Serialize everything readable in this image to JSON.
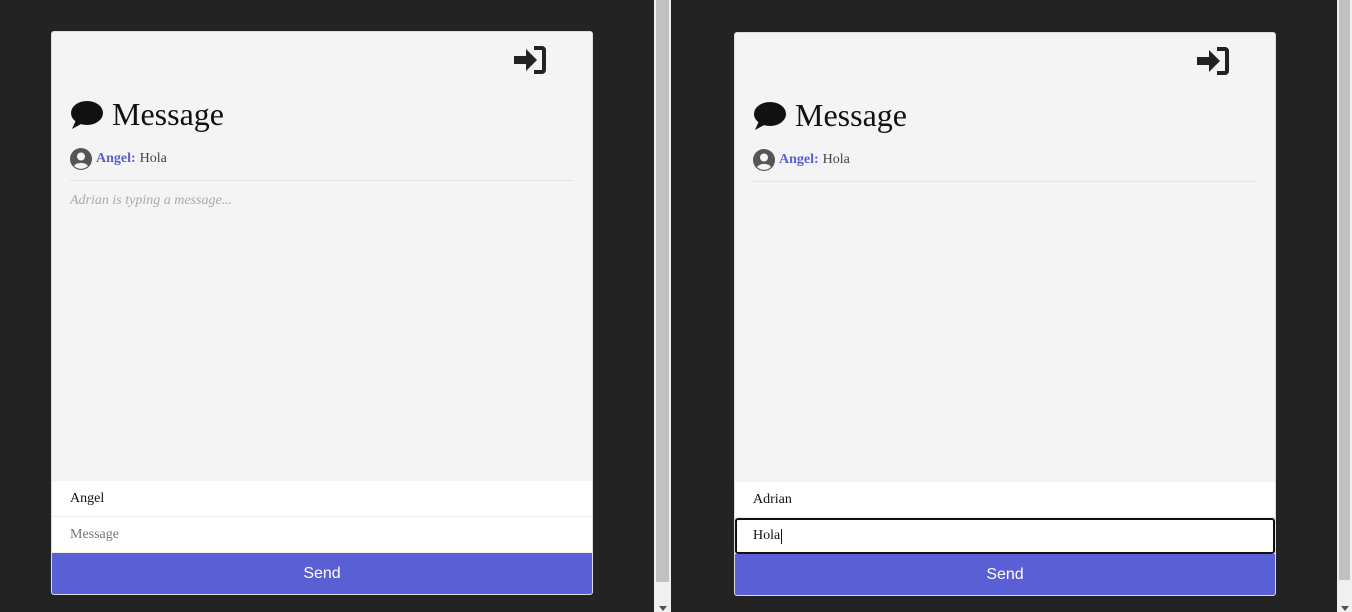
{
  "panes": {
    "left": {
      "title": "Message",
      "messages": [
        {
          "author": "Angel:",
          "text": "Hola"
        }
      ],
      "typing_indicator": "Adrian is typing a message...",
      "name_value": "Angel",
      "message_placeholder": "Message",
      "message_value": "",
      "send_label": "Send"
    },
    "right": {
      "title": "Message",
      "messages": [
        {
          "author": "Angel:",
          "text": "Hola"
        }
      ],
      "typing_indicator": "",
      "name_value": "Adrian",
      "message_placeholder": "Message",
      "message_value": "Hola",
      "send_label": "Send"
    }
  },
  "icons": {
    "login": "sign-in-icon",
    "title": "comment-icon",
    "avatar": "user-circle-icon"
  },
  "colors": {
    "page_background": "#232323",
    "card_background": "#f4f4f4",
    "accent": "#5a5fd6",
    "author_name": "#5a5fd6"
  }
}
